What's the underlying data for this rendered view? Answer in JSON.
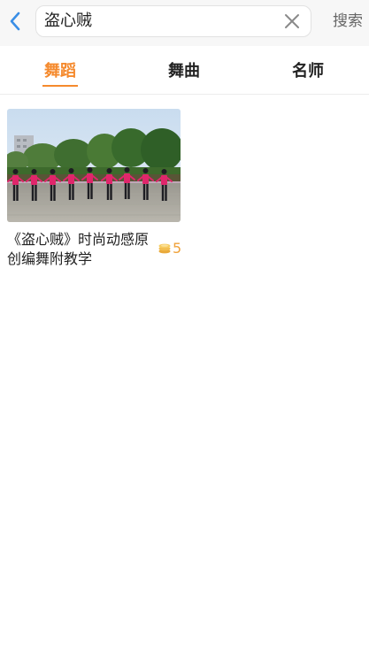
{
  "search": {
    "query": "盗心贼",
    "submit_label": "搜索"
  },
  "tabs": [
    {
      "label": "舞蹈",
      "active": true
    },
    {
      "label": "舞曲",
      "active": false
    },
    {
      "label": "名师",
      "active": false
    }
  ],
  "results": [
    {
      "title": "《盗心贼》时尚动感原创编舞附教学",
      "coins": "5"
    }
  ],
  "colors": {
    "accent": "#f58a2d",
    "back_arrow": "#3a8ee6",
    "coin": "#f0a23a"
  },
  "icons": {
    "back": "chevron-left-icon",
    "clear": "close-icon",
    "coin": "coin-icon"
  }
}
